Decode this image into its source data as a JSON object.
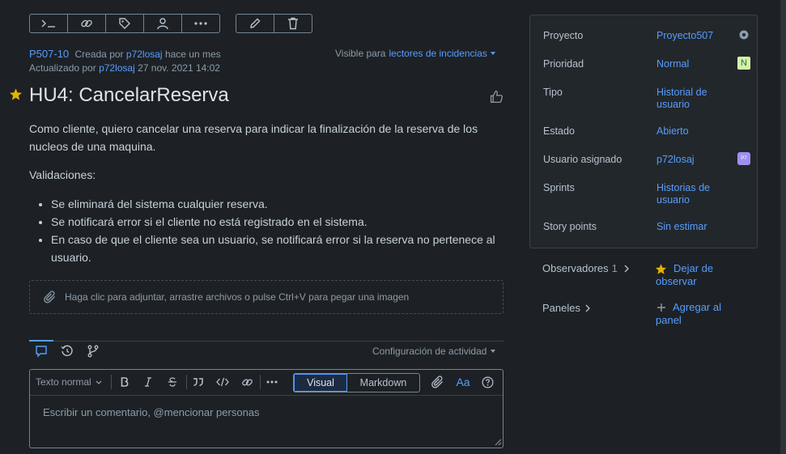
{
  "toolbar": {
    "left_buttons": [
      "terminal-icon",
      "link-icon",
      "tag-icon",
      "user-icon",
      "more-icon"
    ],
    "right_buttons": [
      "edit-icon",
      "delete-icon"
    ]
  },
  "issue": {
    "id": "P507-10",
    "created_prefix": "Creada por",
    "created_by": "p72losaj",
    "created_when": "hace un mes",
    "updated_prefix": "Actualizado por",
    "updated_by": "p72losaj",
    "updated_when": "27 nov. 2021 14:02",
    "visibility_prefix": "Visible para",
    "visibility_value": "lectores de incidencias",
    "title": "HU4: CancelarReserva",
    "description": "Como cliente, quiero cancelar una reserva para indicar la finalización de la reserva de los nucleos de una maquina.",
    "validations_heading": "Validaciones:",
    "bullets": [
      "Se eliminará del sistema cualquier reserva.",
      "Se notificará error si el cliente no está registrado en el sistema.",
      "En caso de que el cliente sea un usuario, se notificará error si la reserva no pertenece al usuario."
    ],
    "attach_text": "Haga clic para adjuntar, arrastre archivos o pulse Ctrl+V para pegar una imagen"
  },
  "activity": {
    "settings_label": "Configuración de actividad",
    "format_select": "Texto normal",
    "mode_visual": "Visual",
    "mode_markdown": "Markdown",
    "format_glyph": "Aa",
    "comment_placeholder": "Escribir un comentario, @mencionar personas"
  },
  "details": {
    "proyecto_label": "Proyecto",
    "proyecto_value": "Proyecto507",
    "prioridad_label": "Prioridad",
    "prioridad_value": "Normal",
    "prioridad_badge": "N",
    "tipo_label": "Tipo",
    "tipo_value": "Historial de usuario",
    "estado_label": "Estado",
    "estado_value": "Abierto",
    "usuario_label": "Usuario asignado",
    "usuario_value": "p72losaj",
    "usuario_avatar": "P7",
    "sprints_label": "Sprints",
    "sprints_value": "Historias de usuario",
    "story_label": "Story points",
    "story_value": "Sin estimar"
  },
  "sidebar": {
    "observadores_label": "Observadores",
    "observadores_count": "1",
    "dejar_label": "Dejar de observar",
    "paneles_label": "Paneles",
    "agregar_label": "Agregar al panel"
  },
  "colors": {
    "background": "#1d2125",
    "panel": "#22272b",
    "link": "#579dff",
    "star": "#e2b203",
    "priority_badge": "#d3f1a7",
    "avatar": "#9f8fef"
  }
}
